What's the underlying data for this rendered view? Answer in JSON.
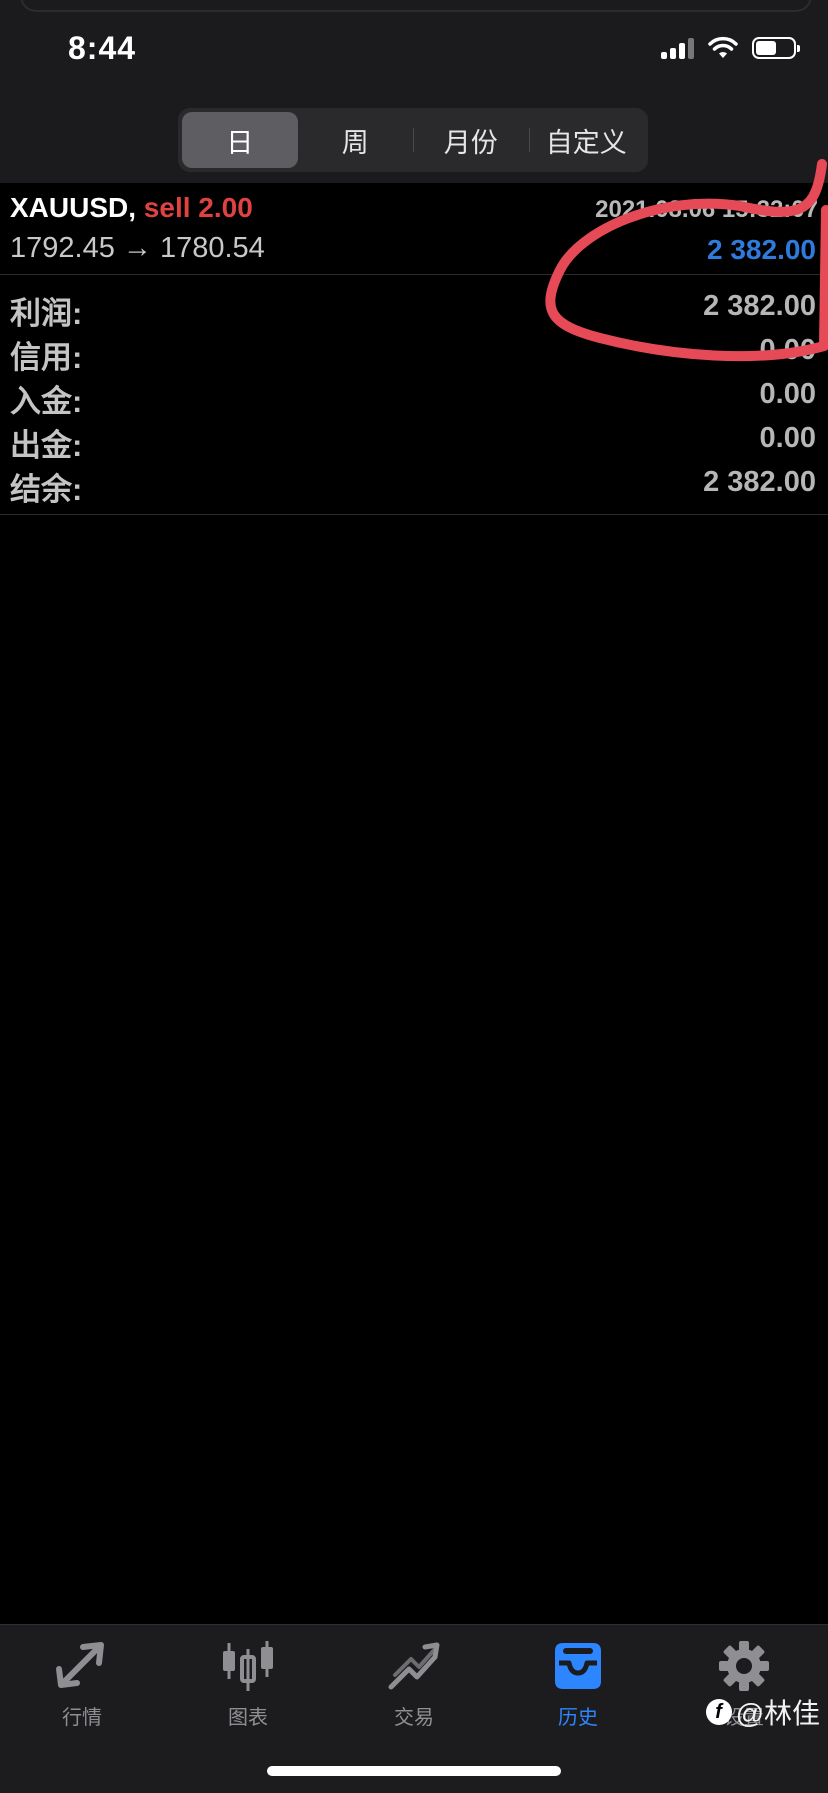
{
  "status_bar": {
    "time": "8:44"
  },
  "period_tabs": [
    {
      "label": "日",
      "active": true
    },
    {
      "label": "周",
      "active": false
    },
    {
      "label": "月份",
      "active": false
    },
    {
      "label": "自定义",
      "active": false
    }
  ],
  "trade": {
    "symbol": "XAUUSD",
    "comma": ",",
    "side_volume": "sell 2.00",
    "datetime": "2021.08.06 15:32:07",
    "prices": "1792.45 → 1780.54",
    "profit": "2 382.00"
  },
  "summary": [
    {
      "label": "利润:",
      "value": "2 382.00"
    },
    {
      "label": "信用:",
      "value": "0.00"
    },
    {
      "label": "入金:",
      "value": "0.00"
    },
    {
      "label": "出金:",
      "value": "0.00"
    },
    {
      "label": "结余:",
      "value": "2 382.00"
    }
  ],
  "tabbar": [
    {
      "label": "行情",
      "icon": "quotes-arrows-icon",
      "active": false
    },
    {
      "label": "图表",
      "icon": "candlestick-chart-icon",
      "active": false
    },
    {
      "label": "交易",
      "icon": "trade-trend-icon",
      "active": false
    },
    {
      "label": "历史",
      "icon": "history-tray-icon",
      "active": true
    },
    {
      "label": "设置",
      "icon": "gear-icon",
      "active": false
    }
  ],
  "watermark": {
    "text": "@林佳"
  },
  "colors": {
    "sell": "#e0433f",
    "profit": "#2f7bdd",
    "active_tab": "#2d86ff",
    "annotation": "#e64a57"
  }
}
